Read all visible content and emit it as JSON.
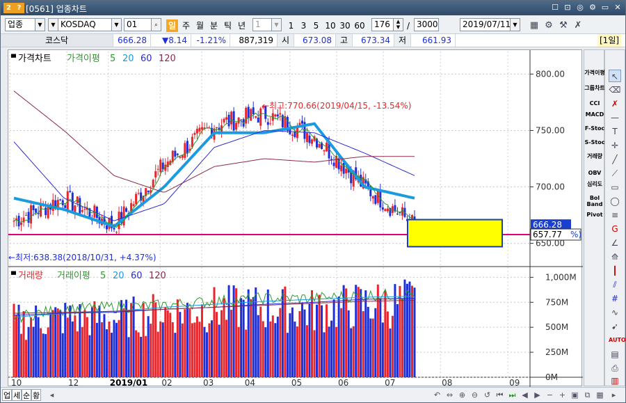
{
  "window": {
    "badge_a": "2",
    "badge_b": "?",
    "title": "[0561] 업종차트",
    "controls": [
      "☐",
      "🖫",
      "◎",
      "⚙",
      "▭",
      "✕"
    ]
  },
  "toolbar": {
    "market_select": "업종",
    "index_name": "KOSDAQ",
    "index_code": "01",
    "periods": [
      "일",
      "주",
      "월",
      "분",
      "틱",
      "년"
    ],
    "active_period": "일",
    "interval_select": "1",
    "intervals": [
      "1",
      "3",
      "5",
      "10",
      "30",
      "60"
    ],
    "count_value": "176",
    "range_value": "3000",
    "date_value": "2019/07/11",
    "label_1day": "[1일]"
  },
  "quote": {
    "name": "코스닥",
    "price": "666.28",
    "change": "▼8.14",
    "change_pct": "-1.21%",
    "volume": "887,319",
    "open_label": "시",
    "open": "673.08",
    "high_label": "고",
    "high": "673.34",
    "low_label": "저",
    "low": "661.93"
  },
  "price_panel": {
    "legend_title": "가격차트",
    "ma_title": "가격이평",
    "ma_periods": [
      "5",
      "20",
      "60",
      "120"
    ],
    "max_label": "←최고:770.66(2019/04/15, -13.54%)",
    "min_label": "←최저:638.38(2018/10/31, +4.37%)",
    "current_price_tag": "666.28",
    "hline_tag": "657.77",
    "hline_pct": "%)",
    "y_ticks": [
      "800.00",
      "750.00",
      "700.00",
      "650.00"
    ]
  },
  "volume_panel": {
    "legend_title": "거래량",
    "ma_title": "거래이평",
    "ma_periods": [
      "5",
      "20",
      "60",
      "120"
    ],
    "y_ticks": [
      "1,000M",
      "750M",
      "500M",
      "250M",
      "0M"
    ]
  },
  "x_axis": {
    "labels": [
      "10",
      "12",
      "2019/01",
      "02",
      "03",
      "04",
      "05",
      "06",
      "07",
      "08",
      "09"
    ]
  },
  "right_indicators": [
    "가격이평",
    "그룹차트",
    "CCI",
    "MACD",
    "F-Stoc",
    "S-Stoc",
    "거래량",
    "OBV",
    "심리도",
    "Bol Band",
    "Pivot"
  ],
  "drawing_tools": [
    "pointer-icon",
    "eraser-icon",
    "delete-all-icon",
    "text-icon",
    "crosshair-icon",
    "line-icon",
    "ruler-icon",
    "rect-icon",
    "ellipse-icon",
    "fibo-icon",
    "gann-icon",
    "angle-icon",
    "speed-icon",
    "bars-icon",
    "channel-icon",
    "grid-icon",
    "wave-icon",
    "auto-icon",
    "page-icon",
    "print-icon",
    "chart-icon"
  ],
  "bottom_tabs": [
    "업",
    "세",
    "순",
    "황"
  ],
  "colors": {
    "up": "#e8262b",
    "down": "#1e2fd6",
    "ma5": "#2b9a2b",
    "ma20": "#1a9be0",
    "ma60": "#2a2ad0",
    "ma120": "#8a2a4a",
    "hline": "#e0007a",
    "highlight_box": "#ffff00"
  },
  "chart_data": [
    {
      "type": "line",
      "title": "가격차트",
      "x": [
        "2018-10",
        "2018-12",
        "2019-01",
        "2019-02",
        "2019-03",
        "2019-04",
        "2019-05",
        "2019-06",
        "2019-07"
      ],
      "series": [
        {
          "name": "가격",
          "values": [
            670,
            690,
            665,
            720,
            755,
            765,
            745,
            700,
            666.28
          ]
        },
        {
          "name": "20",
          "values": [
            690,
            680,
            665,
            700,
            748,
            748,
            756,
            700,
            690
          ]
        },
        {
          "name": "60",
          "values": [
            740,
            690,
            670,
            685,
            735,
            750,
            748,
            730,
            710
          ]
        },
        {
          "name": "120",
          "values": [
            785,
            750,
            710,
            695,
            718,
            725,
            722,
            727,
            727
          ]
        }
      ],
      "ylim": [
        630,
        820
      ],
      "max": 770.66,
      "min": 638.38
    },
    {
      "type": "bar",
      "title": "거래량",
      "x": [
        "2018-10",
        "2018-12",
        "2019-01",
        "2019-02",
        "2019-03",
        "2019-04",
        "2019-05",
        "2019-06",
        "2019-07"
      ],
      "values": [
        650,
        700,
        680,
        760,
        800,
        820,
        780,
        850,
        887
      ],
      "ylim": [
        0,
        1100
      ]
    }
  ]
}
